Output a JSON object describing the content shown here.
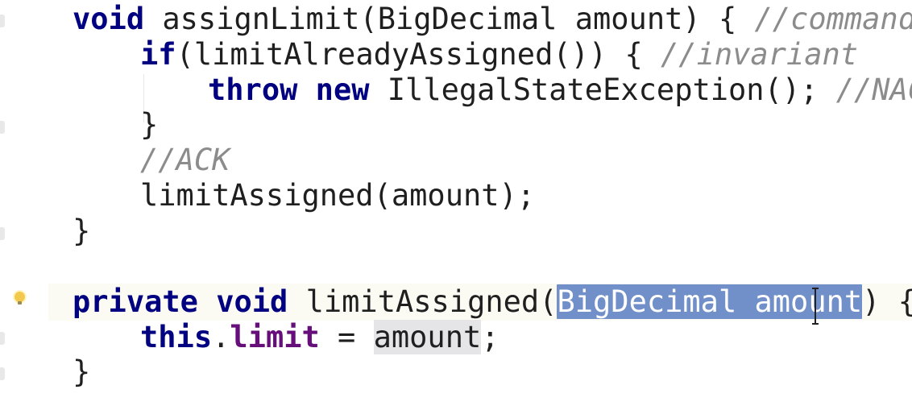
{
  "editor": {
    "language": "java",
    "lines": [
      {
        "tokens": [
          {
            "t": "kw",
            "v": "void"
          },
          {
            "t": "plain",
            "v": " assignLimit(BigDecimal amount) { "
          },
          {
            "t": "cmt",
            "v": "//command"
          }
        ]
      },
      {
        "tokens": [
          {
            "t": "kw",
            "v": "if"
          },
          {
            "t": "plain",
            "v": "(limitAlreadyAssigned()) { "
          },
          {
            "t": "cmt",
            "v": "//invariant"
          }
        ]
      },
      {
        "tokens": [
          {
            "t": "kw",
            "v": "throw"
          },
          {
            "t": "plain",
            "v": " "
          },
          {
            "t": "kw",
            "v": "new"
          },
          {
            "t": "plain",
            "v": " IllegalStateException(); "
          },
          {
            "t": "cmt",
            "v": "//NACK"
          }
        ]
      },
      {
        "tokens": [
          {
            "t": "plain",
            "v": "}"
          }
        ]
      },
      {
        "tokens": [
          {
            "t": "cmt",
            "v": "//ACK"
          }
        ]
      },
      {
        "tokens": [
          {
            "t": "plain",
            "v": "limitAssigned(amount);"
          }
        ]
      },
      {
        "tokens": [
          {
            "t": "plain",
            "v": "}"
          }
        ]
      },
      {
        "tokens": []
      },
      {
        "tokens": [
          {
            "t": "kw",
            "v": "private"
          },
          {
            "t": "plain",
            "v": " "
          },
          {
            "t": "kw",
            "v": "void"
          },
          {
            "t": "plain",
            "v": " limitAssigned("
          },
          {
            "t": "sel",
            "v": "BigDecimal amount"
          },
          {
            "t": "plain",
            "v": ") {"
          }
        ]
      },
      {
        "tokens": [
          {
            "t": "kw",
            "v": "this"
          },
          {
            "t": "plain",
            "v": "."
          },
          {
            "t": "field",
            "v": "limit"
          },
          {
            "t": "plain",
            "v": " = "
          },
          {
            "t": "usage",
            "v": "amount"
          },
          {
            "t": "plain",
            "v": ";"
          }
        ]
      },
      {
        "tokens": [
          {
            "t": "plain",
            "v": "}"
          }
        ]
      }
    ],
    "selected_text": "BigDecimal amount",
    "colors": {
      "keyword": "#000080",
      "comment": "#8c8c8c",
      "field": "#660e7a",
      "selection": "#7190c9",
      "usage_highlight": "#e5e5e8"
    }
  }
}
